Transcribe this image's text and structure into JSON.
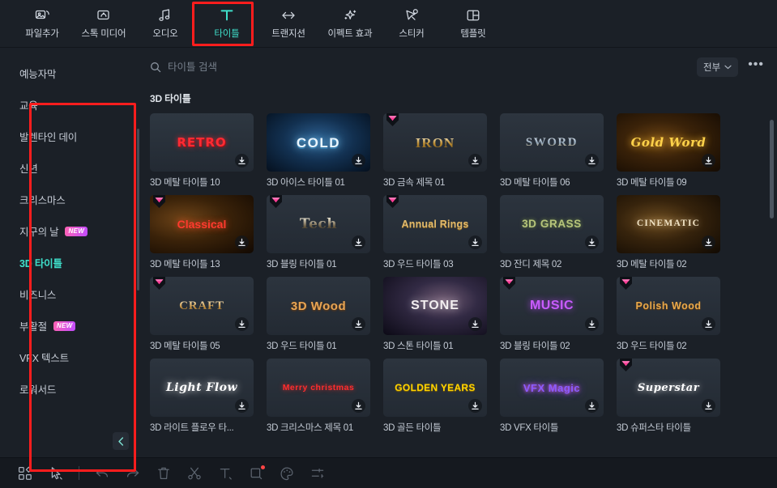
{
  "toolbar": {
    "items": [
      {
        "label": "파일추가",
        "icon": "add-media-icon",
        "active": false
      },
      {
        "label": "스톡 미디어",
        "icon": "stock-media-icon",
        "active": false
      },
      {
        "label": "오디오",
        "icon": "audio-note-icon",
        "active": false
      },
      {
        "label": "타이틀",
        "icon": "title-text-icon",
        "active": true
      },
      {
        "label": "트랜지션",
        "icon": "transition-arrows-icon",
        "active": false
      },
      {
        "label": "이펙트 효과",
        "icon": "effects-sparkle-icon",
        "active": false
      },
      {
        "label": "스티커",
        "icon": "sticker-icon",
        "active": false
      },
      {
        "label": "템플릿",
        "icon": "template-grid-icon",
        "active": false
      }
    ]
  },
  "sidebar": {
    "categories": [
      {
        "label": "예능자막",
        "selected": false,
        "badge": ""
      },
      {
        "label": "교육",
        "selected": false,
        "badge": ""
      },
      {
        "label": "발렌타인 데이",
        "selected": false,
        "badge": ""
      },
      {
        "label": "신년",
        "selected": false,
        "badge": ""
      },
      {
        "label": "크리스마스",
        "selected": false,
        "badge": ""
      },
      {
        "label": "지구의 날",
        "selected": false,
        "badge": "NEW"
      },
      {
        "label": "3D 타이틀",
        "selected": true,
        "badge": ""
      },
      {
        "label": "비즈니스",
        "selected": false,
        "badge": ""
      },
      {
        "label": "부활절",
        "selected": false,
        "badge": "NEW"
      },
      {
        "label": "VFX 텍스트",
        "selected": false,
        "badge": ""
      },
      {
        "label": "로워서드",
        "selected": false,
        "badge": ""
      }
    ],
    "collapse_icon": "chevron-left-icon"
  },
  "search": {
    "placeholder": "타이틀 검색",
    "value": "",
    "icon": "search-icon",
    "filter_label": "전부",
    "filter_caret": "chevron-down-icon",
    "more_label": "•••"
  },
  "content": {
    "section_title": "3D 타이틀",
    "items": [
      {
        "caption": "3D 메탈 타이틀 10",
        "preview": "RETRO",
        "gem": false,
        "style": "retro"
      },
      {
        "caption": "3D 아이스 타이틀 01",
        "preview": "COLD",
        "gem": false,
        "style": "cold"
      },
      {
        "caption": "3D 금속 제목 01",
        "preview": "IRON",
        "gem": true,
        "style": "iron"
      },
      {
        "caption": "3D 메탈 타이틀 06",
        "preview": "SWORD",
        "gem": false,
        "style": "sword"
      },
      {
        "caption": "3D 메탈 타이틀 09",
        "preview": "Gold Word",
        "gem": false,
        "style": "goldword"
      },
      {
        "caption": "3D 메탈 타이틀 13",
        "preview": "Classical",
        "gem": true,
        "style": "classical"
      },
      {
        "caption": "3D 블링 타이틀 01",
        "preview": "Tech",
        "gem": true,
        "style": "tech"
      },
      {
        "caption": "3D 우드 타이틀 03",
        "preview": "Annual Rings",
        "gem": true,
        "style": "annual"
      },
      {
        "caption": "3D 잔디 제목 02",
        "preview": "3D GRASS",
        "gem": false,
        "style": "grass"
      },
      {
        "caption": "3D 메탈 타이틀 02",
        "preview": "CINEMATIC",
        "gem": false,
        "style": "cinematic"
      },
      {
        "caption": "3D 메탈 타이틀 05",
        "preview": "CRAFT",
        "gem": true,
        "style": "craft"
      },
      {
        "caption": "3D 우드 타이틀 01",
        "preview": "3D Wood",
        "gem": false,
        "style": "wood"
      },
      {
        "caption": "3D 스톤 타이틀 01",
        "preview": "STONE",
        "gem": false,
        "style": "stone"
      },
      {
        "caption": "3D 블링 타이틀 02",
        "preview": "MUSIC",
        "gem": true,
        "style": "music"
      },
      {
        "caption": "3D 우드 타이틀 02",
        "preview": "Polish Wood",
        "gem": true,
        "style": "polish"
      },
      {
        "caption": "3D 라이트 플로우 타...",
        "preview": "Light Flow",
        "gem": false,
        "style": "lightflow"
      },
      {
        "caption": "3D 크리스마스 제목 01",
        "preview": "Merry christmas",
        "gem": false,
        "style": "merry"
      },
      {
        "caption": "3D 골든 타이틀",
        "preview": "GOLDEN YEARS",
        "gem": false,
        "style": "golden"
      },
      {
        "caption": "3D VFX 타이틀",
        "preview": "VFX Magic",
        "gem": false,
        "style": "vfx"
      },
      {
        "caption": "3D 슈퍼스타 타이틀",
        "preview": "Superstar",
        "gem": true,
        "style": "superstar"
      }
    ]
  },
  "bottombar": {
    "items": [
      {
        "icon": "layout-tiles-icon",
        "dim": false,
        "dot": false
      },
      {
        "icon": "pointer-select-icon",
        "dim": false,
        "dot": false
      },
      {
        "icon": "separator",
        "dim": false,
        "dot": false
      },
      {
        "icon": "undo-icon",
        "dim": true,
        "dot": false
      },
      {
        "icon": "redo-icon",
        "dim": true,
        "dot": false
      },
      {
        "icon": "trash-delete-icon",
        "dim": true,
        "dot": false
      },
      {
        "icon": "scissors-split-icon",
        "dim": true,
        "dot": false
      },
      {
        "icon": "text-tool-icon",
        "dim": true,
        "dot": false
      },
      {
        "icon": "crop-tool-icon",
        "dim": true,
        "dot": true
      },
      {
        "icon": "color-palette-icon",
        "dim": true,
        "dot": false
      },
      {
        "icon": "adjust-sliders-icon",
        "dim": true,
        "dot": false
      }
    ]
  },
  "colors": {
    "accent": "#3fe0cb",
    "highlight_box": "#ff1d1d",
    "panel_bg": "#1b2027",
    "app_bg": "#15191f",
    "badge_new": "#ff63b3"
  }
}
